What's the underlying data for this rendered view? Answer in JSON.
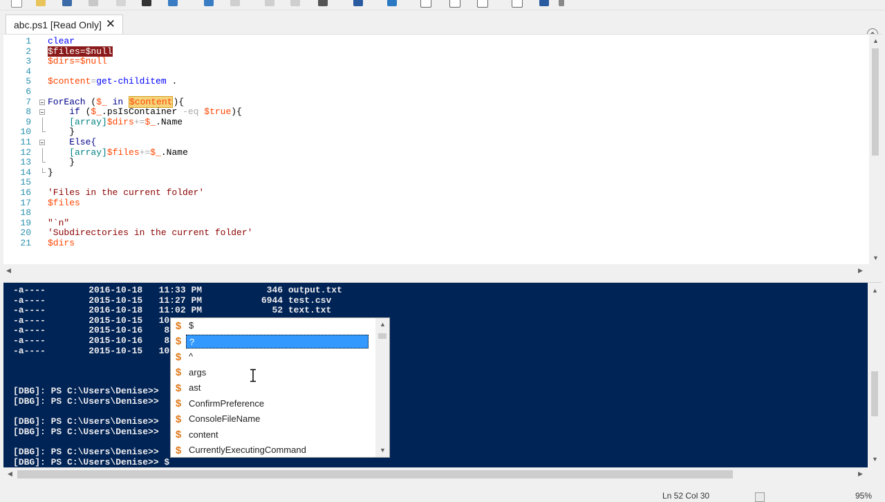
{
  "tab": {
    "title": "abc.ps1 [Read Only]",
    "close_glyph": "✕"
  },
  "editor": {
    "line_numbers": [
      "1",
      "2",
      "3",
      "4",
      "5",
      "6",
      "7",
      "8",
      "9",
      "10",
      "11",
      "12",
      "13",
      "14",
      "15",
      "16",
      "17",
      "18",
      "19",
      "20",
      "21"
    ],
    "lines": {
      "l1": "clear",
      "l2": "$files=$null",
      "l3": "$dirs=$null",
      "l5a": "$content",
      "l5b": "=",
      "l5c": "get-childitem",
      "l5d": " .",
      "l7a": "ForEach",
      "l7b": " (",
      "l7c": "$_",
      "l7d": " in ",
      "l7e": "$content",
      "l7f": "){",
      "l8a": "    if",
      "l8b": " (",
      "l8c": "$_",
      "l8d": ".psIsContainer ",
      "l8e": "-eq",
      "l8f": " ",
      "l8g": "$true",
      "l8h": "){",
      "l9a": "    ",
      "l9b": "[array]",
      "l9c": "$dirs",
      "l9d": "+=",
      "l9e": "$_",
      "l9f": ".Name",
      "l10": "    }",
      "l11": "    Else{",
      "l12a": "    ",
      "l12b": "[array]",
      "l12c": "$files",
      "l12d": "+=",
      "l12e": "$_",
      "l12f": ".Name",
      "l13": "    }",
      "l14": "}",
      "l16": "'Files in the current folder'",
      "l17": "$files",
      "l19": "\"`n\"",
      "l20": "'Subdirectories in the current folder'",
      "l21": "$dirs"
    }
  },
  "console": {
    "rows": [
      "-a----        2016-10-18   11:33 PM            346 output.txt",
      "-a----        2015-10-15   11:27 PM           6944 test.csv",
      "-a----        2016-10-18   11:02 PM             52 text.txt",
      "-a----        2015-10-15   10:",
      "-a----        2015-10-16    8:",
      "-a----        2015-10-16    8:",
      "-a----        2015-10-15   10:"
    ],
    "prompts": [
      "[DBG]: PS C:\\Users\\Denise>>",
      "[DBG]: PS C:\\Users\\Denise>>",
      "[DBG]: PS C:\\Users\\Denise>>",
      "[DBG]: PS C:\\Users\\Denise>>",
      "[DBG]: PS C:\\Users\\Denise>>",
      "[DBG]: PS C:\\Users\\Denise>> $"
    ]
  },
  "intellisense": {
    "icon_glyph": "$",
    "items": [
      "$",
      "?",
      "^",
      "args",
      "ast",
      "ConfirmPreference",
      "ConsoleFileName",
      "content",
      "CurrentlyExecutingCommand"
    ],
    "selected_index": 1
  },
  "status": {
    "position": "Ln 52  Col 30",
    "zoom": "95%"
  },
  "colors": {
    "console_bg": "#012456",
    "selection": "#3399ff",
    "breakpoint": "#8b1a1a",
    "highlight": "#f5d37a"
  }
}
